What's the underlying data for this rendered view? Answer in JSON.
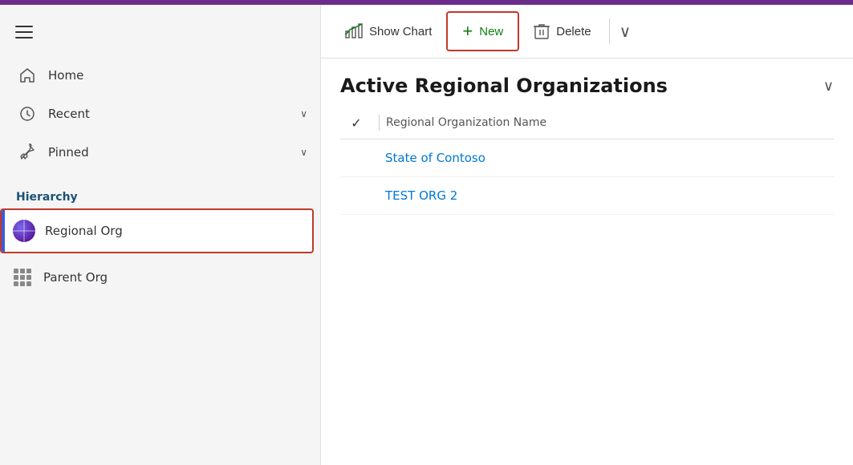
{
  "topBar": {},
  "sidebar": {
    "hamburger_label": "Menu",
    "nav": [
      {
        "id": "home",
        "label": "Home",
        "icon": "home",
        "chevron": false
      },
      {
        "id": "recent",
        "label": "Recent",
        "icon": "clock",
        "chevron": true
      },
      {
        "id": "pinned",
        "label": "Pinned",
        "icon": "pin",
        "chevron": true
      }
    ],
    "hierarchy_label": "Hierarchy",
    "hierarchy_items": [
      {
        "id": "regional-org",
        "label": "Regional Org",
        "icon": "globe",
        "active": true
      },
      {
        "id": "parent-org",
        "label": "Parent Org",
        "icon": "grid",
        "active": false
      }
    ]
  },
  "toolbar": {
    "show_chart_label": "Show Chart",
    "new_label": "New",
    "delete_label": "Delete"
  },
  "main": {
    "page_title": "Active Regional Organizations",
    "column_header": "Regional Organization Name",
    "rows": [
      {
        "id": "row1",
        "name": "State of Contoso"
      },
      {
        "id": "row2",
        "name": "TEST ORG 2"
      }
    ]
  },
  "colors": {
    "accent_purple": "#6b2d8b",
    "accent_blue": "#3b5bdb",
    "link_blue": "#0078d4",
    "new_green": "#107c10",
    "highlight_red": "#c0392b"
  }
}
